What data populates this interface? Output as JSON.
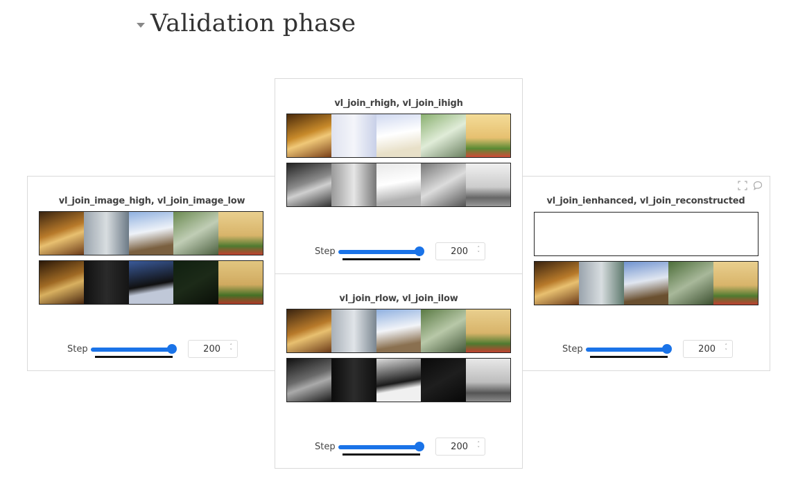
{
  "section": {
    "title": "Validation phase"
  },
  "panels": [
    {
      "title": "vl_join_image_high, vl_join_image_low",
      "step_label": "Step",
      "step_value": "200",
      "slider_fraction": 1.0
    },
    {
      "title": "vl_join_rhigh, vl_join_ihigh",
      "step_label": "Step",
      "step_value": "200",
      "slider_fraction": 1.0
    },
    {
      "title": "vl_join_rlow, vl_join_ilow",
      "step_label": "Step",
      "step_value": "200",
      "slider_fraction": 1.0
    },
    {
      "title": "vl_join_ienhanced, vl_join_reconstructed",
      "step_label": "Step",
      "step_value": "200",
      "slider_fraction": 1.0
    }
  ],
  "icons": [
    "fullscreen-icon",
    "comment-icon",
    "caret-down-icon"
  ],
  "colors": {
    "accent": "#1a73e8",
    "border": "#d9d9d9"
  }
}
